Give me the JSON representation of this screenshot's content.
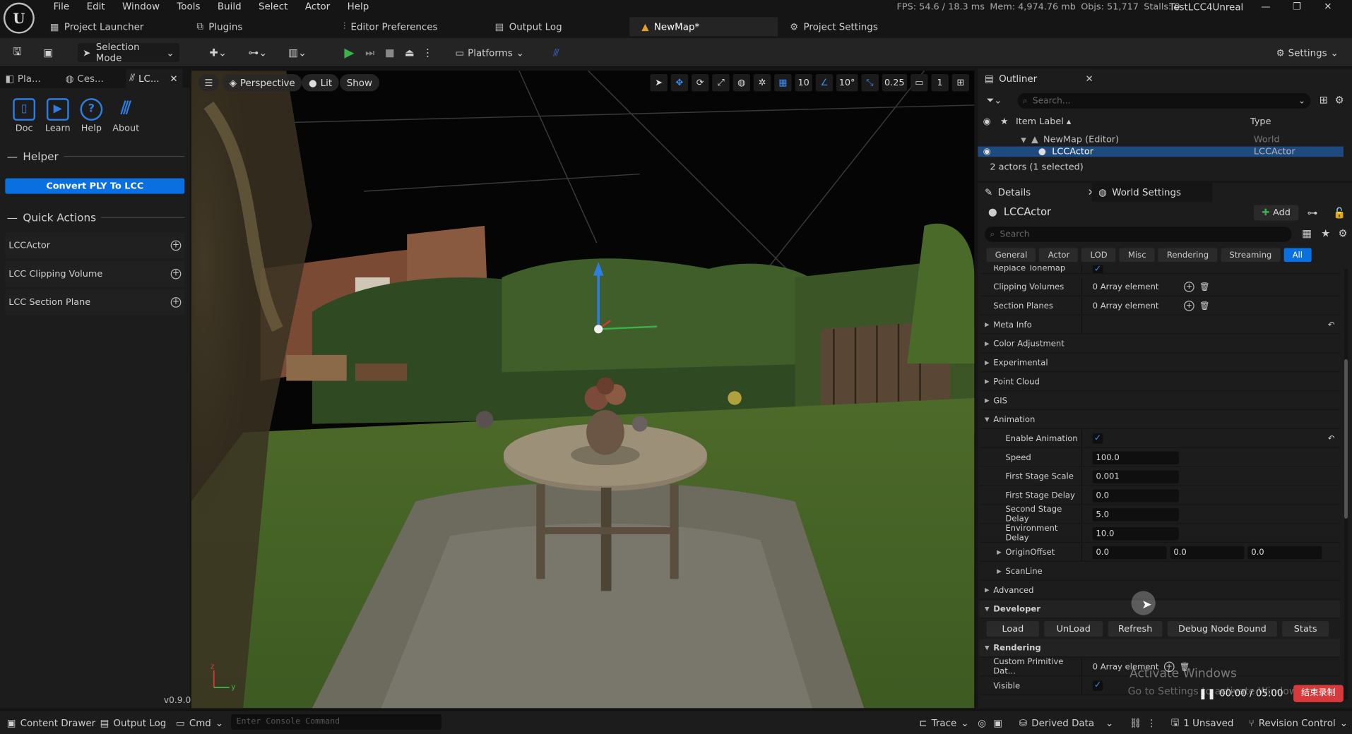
{
  "menu": [
    "File",
    "Edit",
    "Window",
    "Tools",
    "Build",
    "Select",
    "Actor",
    "Help"
  ],
  "status": {
    "fps": "FPS: 54.6 / 18.3 ms",
    "mem": "Mem: 4,974.76 mb",
    "objs": "Objs: 51,717",
    "stalls": "Stalls: 0"
  },
  "project_name": "TestLCC4Unreal",
  "doc_tabs": [
    {
      "label": "Project Launcher"
    },
    {
      "label": "Plugins"
    },
    {
      "label": "Editor Preferences"
    },
    {
      "label": "Output Log"
    },
    {
      "label": "NewMap*"
    },
    {
      "label": "Project Settings"
    }
  ],
  "toolbar": {
    "selection_mode": "Selection Mode",
    "platforms": "Platforms",
    "settings": "Settings"
  },
  "left_tabs": [
    "Pla...",
    "Ces...",
    "LC..."
  ],
  "tools": [
    "Doc",
    "Learn",
    "Help",
    "About"
  ],
  "helper_title": "Helper",
  "convert_button": "Convert PLY To LCC",
  "quick_actions_title": "Quick Actions",
  "quick_actions": [
    "LCCActor",
    "LCC Clipping Volume",
    "LCC Section Plane"
  ],
  "version": "v0.9.0",
  "viewport": {
    "perspective": "Perspective",
    "lit": "Lit",
    "show": "Show",
    "grid_snap": "10",
    "rot_snap": "10°",
    "scale_snap": "0.25",
    "camera_speed": "1"
  },
  "outliner": {
    "tab": "Outliner",
    "search_placeholder": "Search...",
    "col_label": "Item Label",
    "col_type": "Type",
    "rows": [
      {
        "label": "NewMap (Editor)",
        "type": "World"
      },
      {
        "label": "LCCActor",
        "type": "LCCActor"
      }
    ],
    "footer": "2 actors (1 selected)"
  },
  "details": {
    "tab": "Details",
    "tab2": "World Settings",
    "actor_name": "LCCActor",
    "add": "Add",
    "search_placeholder": "Search",
    "filters": [
      "General",
      "Actor",
      "LOD",
      "Misc",
      "Rendering",
      "Streaming",
      "All"
    ],
    "props": {
      "replace_tonemap": "Replace Tonemap",
      "clipping_volumes": "Clipping Volumes",
      "clipping_volumes_val": "0 Array element",
      "section_planes": "Section Planes",
      "section_planes_val": "0 Array element",
      "meta_info": "Meta Info",
      "color_adjustment": "Color Adjustment",
      "experimental": "Experimental",
      "point_cloud": "Point Cloud",
      "gis": "GIS",
      "animation": "Animation",
      "enable_animation": "Enable Animation",
      "speed": "Speed",
      "speed_val": "100.0",
      "first_stage_scale": "First Stage Scale",
      "first_stage_scale_val": "0.001",
      "first_stage_delay": "First Stage Delay",
      "first_stage_delay_val": "0.0",
      "second_stage_delay": "Second Stage Delay",
      "second_stage_delay_val": "5.0",
      "environment_delay": "Environment Delay",
      "environment_delay_val": "10.0",
      "origin_offset": "OriginOffset",
      "origin_x": "0.0",
      "origin_y": "0.0",
      "origin_z": "0.0",
      "scanline": "ScanLine",
      "advanced": "Advanced",
      "developer": "Developer",
      "rendering": "Rendering",
      "custom_primitive": "Custom Primitive Dat...",
      "custom_primitive_val": "0 Array element",
      "visible": "Visible"
    },
    "dev_buttons": [
      "Load",
      "UnLoad",
      "Refresh",
      "Debug Node Bound",
      "Stats"
    ]
  },
  "overlay": {
    "watermark": "Activate Windows",
    "watermark2": "Go to Settings to activate Windows.",
    "rec_time": "00:00 / 05:00",
    "rec_button": "结束录制"
  },
  "bottom": {
    "content_drawer": "Content Drawer",
    "output_log": "Output Log",
    "cmd": "Cmd",
    "console_placeholder": "Enter Console Command",
    "trace": "Trace",
    "derived_data": "Derived Data",
    "unsaved": "1 Unsaved",
    "revision_control": "Revision Control"
  }
}
